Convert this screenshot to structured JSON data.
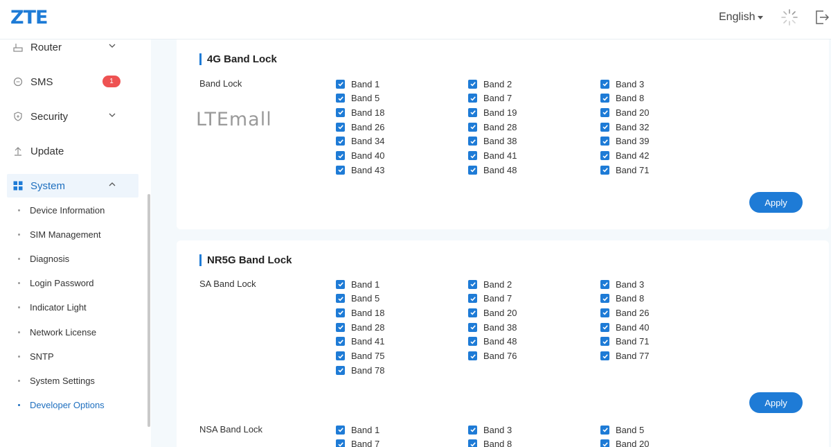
{
  "header": {
    "logo": "ZTE",
    "language": "English"
  },
  "sidebar": {
    "items": [
      {
        "label": "Router"
      },
      {
        "label": "SMS",
        "badge": "1"
      },
      {
        "label": "Security"
      },
      {
        "label": "Update"
      },
      {
        "label": "System"
      }
    ],
    "sub_items": [
      {
        "label": "Device Information"
      },
      {
        "label": "SIM Management"
      },
      {
        "label": "Diagnosis"
      },
      {
        "label": "Login Password"
      },
      {
        "label": "Indicator Light"
      },
      {
        "label": "Network License"
      },
      {
        "label": "SNTP"
      },
      {
        "label": "System Settings"
      },
      {
        "label": "Developer Options"
      }
    ]
  },
  "lte_section": {
    "title": "4G Band Lock",
    "row_label": "Band Lock",
    "watermark": "LTEmall",
    "bands": [
      "Band 1",
      "Band 2",
      "Band 3",
      "Band 5",
      "Band 7",
      "Band 8",
      "Band 18",
      "Band 19",
      "Band 20",
      "Band 26",
      "Band 28",
      "Band 32",
      "Band 34",
      "Band 38",
      "Band 39",
      "Band 40",
      "Band 41",
      "Band 42",
      "Band 43",
      "Band 48",
      "Band 71"
    ],
    "apply_label": "Apply"
  },
  "nr_section": {
    "title": "NR5G Band Lock",
    "sa_label": "SA Band Lock",
    "sa_bands": [
      "Band 1",
      "Band 2",
      "Band 3",
      "Band 5",
      "Band 7",
      "Band 8",
      "Band 18",
      "Band 20",
      "Band 26",
      "Band 28",
      "Band 38",
      "Band 40",
      "Band 41",
      "Band 48",
      "Band 71",
      "Band 75",
      "Band 76",
      "Band 77",
      "Band 78"
    ],
    "apply_label": "Apply",
    "nsa_label": "NSA Band Lock",
    "nsa_bands": [
      "Band 1",
      "Band 3",
      "Band 5",
      "Band 7",
      "Band 8",
      "Band 20"
    ]
  },
  "colors": {
    "accent": "#1e7bd6",
    "badge": "#ee5252",
    "background": "#f4f9fc"
  }
}
